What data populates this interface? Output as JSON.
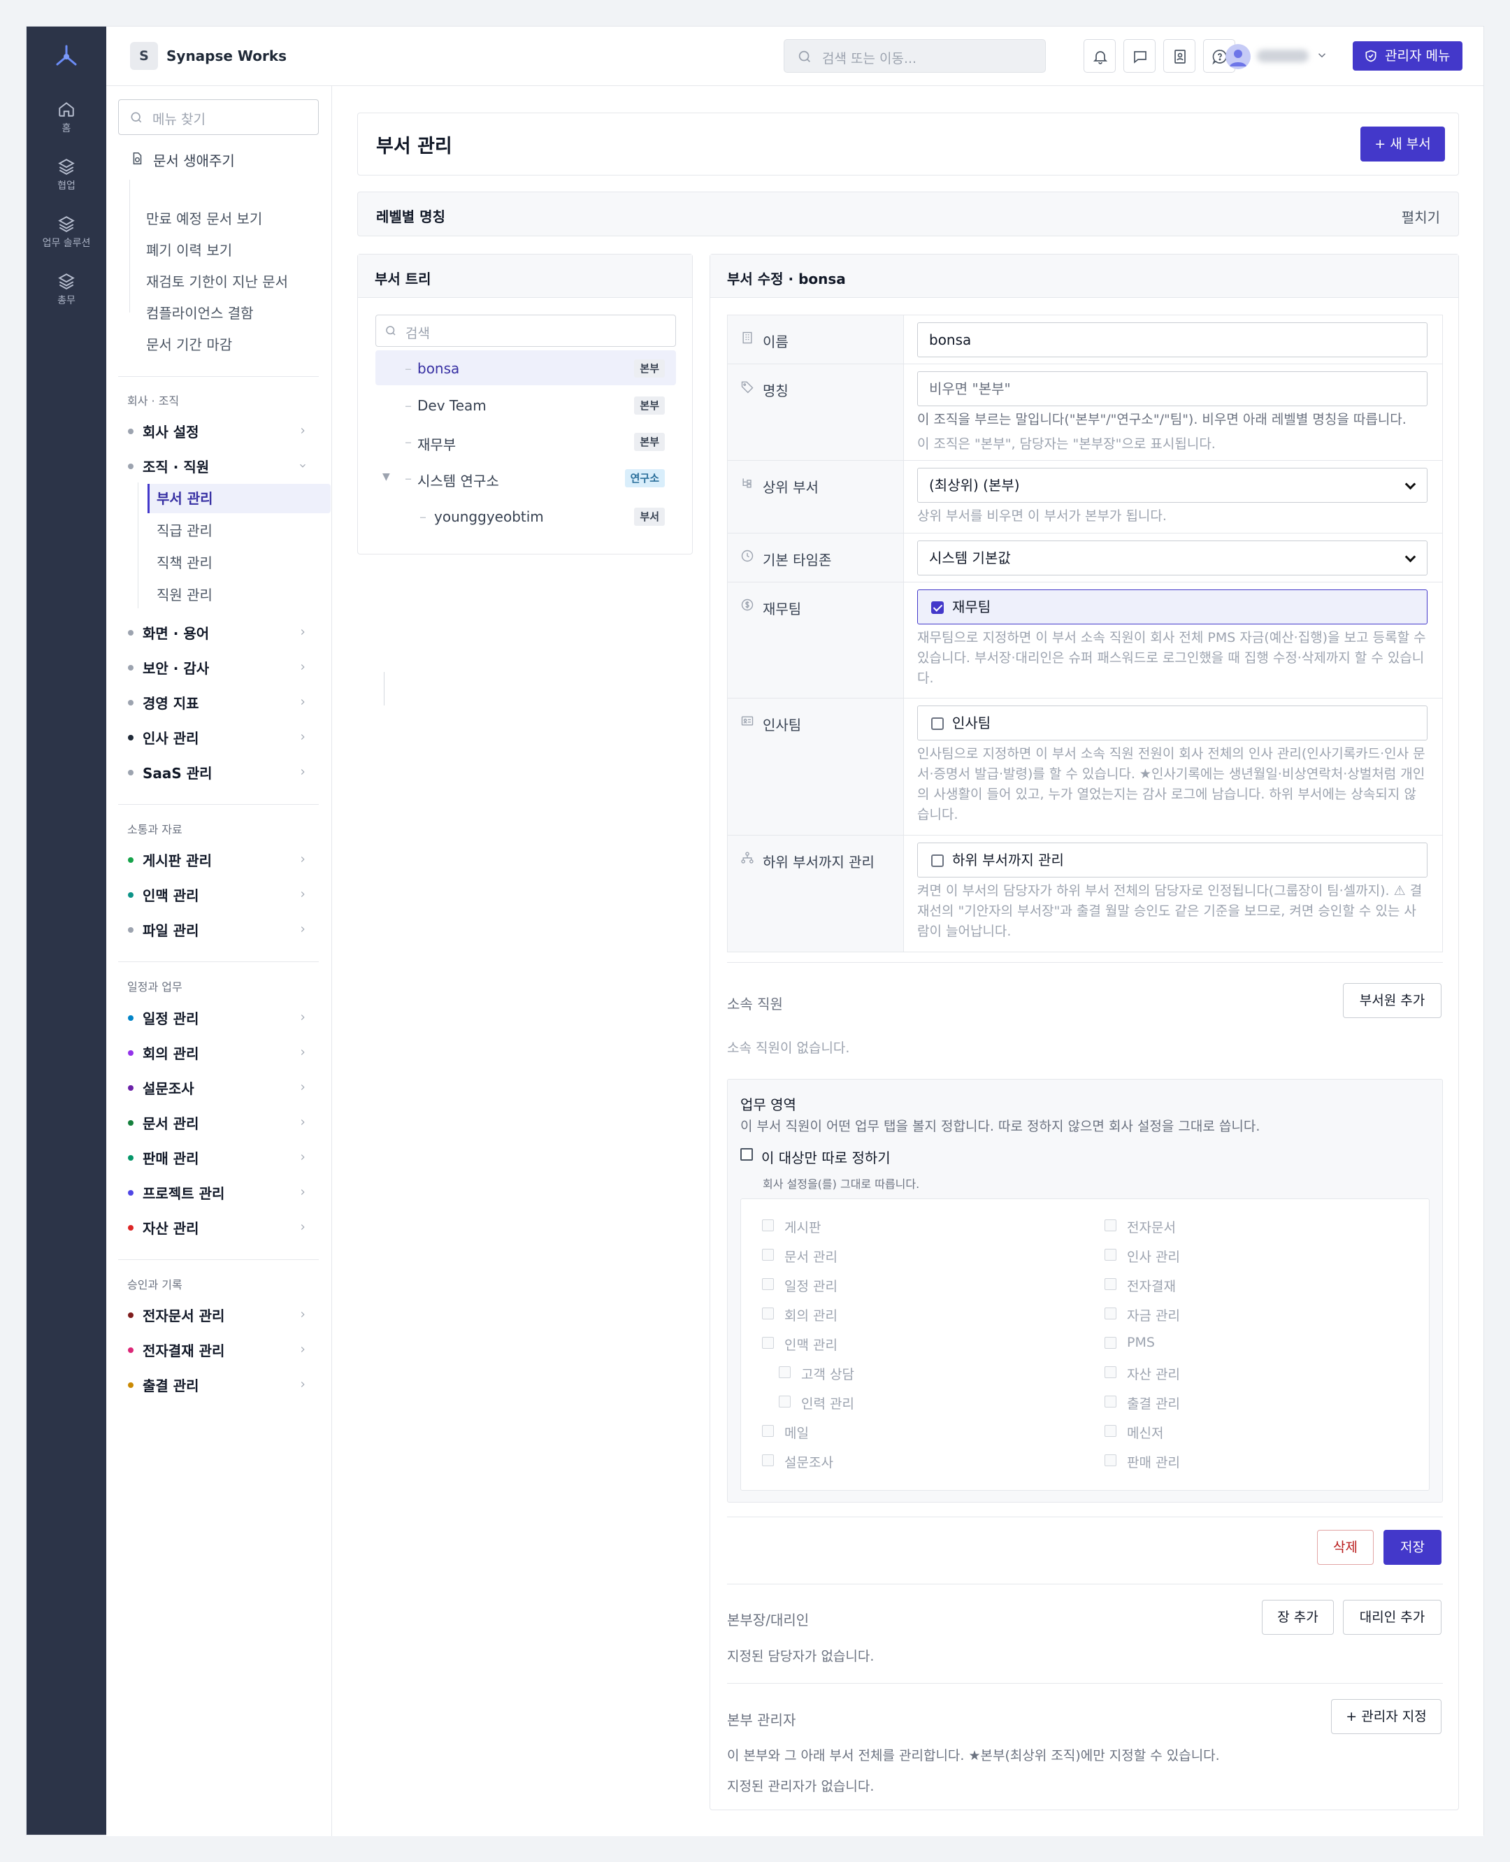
{
  "rail": {
    "items": [
      {
        "label": "홈",
        "icon": "home-icon"
      },
      {
        "label": "협업",
        "icon": "layers-icon"
      },
      {
        "label": "업무 솔루션",
        "icon": "layers-icon"
      },
      {
        "label": "총무",
        "icon": "layers-icon"
      }
    ]
  },
  "header": {
    "workspace_badge": "S",
    "workspace_name": "Synapse Works",
    "search_placeholder": "검색 또는 이동...",
    "admin_label": "관리자 메뉴"
  },
  "sidebar": {
    "search_placeholder": "메뉴 찾기",
    "lifecycle": {
      "label": "문서 생애주기",
      "items": [
        "만료 예정 문서 보기",
        "폐기 이력 보기",
        "재검토 기한이 지난 문서",
        "컴플라이언스 결함",
        "문서 기간 마감"
      ]
    },
    "groups": [
      {
        "title": "회사 · 조직",
        "items": [
          {
            "label": "회사 설정",
            "color": "#9ca3af"
          },
          {
            "label": "조직 · 직원",
            "color": "#9ca3af",
            "expanded": true,
            "subitems": [
              "부서 관리",
              "직급 관리",
              "직책 관리",
              "직원 관리"
            ]
          },
          {
            "label": "화면 · 용어",
            "color": "#9ca3af"
          },
          {
            "label": "보안 · 감사",
            "color": "#9ca3af"
          },
          {
            "label": "경영 지표",
            "color": "#9ca3af"
          },
          {
            "label": "인사 관리",
            "color": "#1f2937"
          },
          {
            "label": "SaaS 관리",
            "color": "#9ca3af"
          }
        ]
      },
      {
        "title": "소통과 자료",
        "items": [
          {
            "label": "게시판 관리",
            "color": "#16a34a"
          },
          {
            "label": "인맥 관리",
            "color": "#0d9488"
          },
          {
            "label": "파일 관리",
            "color": "#9ca3af"
          }
        ]
      },
      {
        "title": "일정과 업무",
        "items": [
          {
            "label": "일정 관리",
            "color": "#0284c7"
          },
          {
            "label": "회의 관리",
            "color": "#9333ea"
          },
          {
            "label": "설문조사",
            "color": "#6b21a8"
          },
          {
            "label": "문서 관리",
            "color": "#15803d"
          },
          {
            "label": "판매 관리",
            "color": "#059669"
          },
          {
            "label": "프로젝트 관리",
            "color": "#4f46e5"
          },
          {
            "label": "자산 관리",
            "color": "#dc2626"
          }
        ]
      },
      {
        "title": "승인과 기록",
        "items": [
          {
            "label": "전자문서 관리",
            "color": "#7f1d1d"
          },
          {
            "label": "전자결재 관리",
            "color": "#db2777"
          },
          {
            "label": "출결 관리",
            "color": "#ca8a04"
          }
        ]
      }
    ]
  },
  "main": {
    "page_title": "부서 관리",
    "new_button": "+ 새 부서",
    "level_names": {
      "title": "레벨별 명칭",
      "expand": "펼치기"
    },
    "tree": {
      "title": "부서 트리",
      "search_placeholder": "검색",
      "nodes": [
        {
          "name": "bonsa",
          "badge": "본부",
          "selected": true
        },
        {
          "name": "Dev Team",
          "badge": "본부"
        },
        {
          "name": "재무부",
          "badge": "본부"
        },
        {
          "name": "시스템 연구소",
          "badge": "연구소",
          "expanded": true
        },
        {
          "name": "younggyeobtim",
          "badge": "부서"
        }
      ]
    },
    "edit": {
      "title": "부서 수정 · bonsa",
      "fields": {
        "name": {
          "label": "이름",
          "value": "bonsa"
        },
        "designation": {
          "label": "명칭",
          "placeholder": "비우면 \"본부\"",
          "help1": "이 조직을 부르는 말입니다(\"본부\"/\"연구소\"/\"팀\"). 비우면 아래 레벨별 명칭을 따릅니다.",
          "help2": "이 조직은 \"본부\", 담당자는 \"본부장\"으로 표시됩니다."
        },
        "parent": {
          "label": "상위 부서",
          "value": "(최상위) (본부)",
          "help": "상위 부서를 비우면 이 부서가 본부가 됩니다."
        },
        "timezone": {
          "label": "기본 타임존",
          "value": "시스템 기본값"
        },
        "finance": {
          "label": "재무팀",
          "check_label": "재무팀",
          "checked": true,
          "help": "재무팀으로 지정하면 이 부서 소속 직원이 회사 전체 PMS 자금(예산·집행)을 보고 등록할 수 있습니다. 부서장·대리인은 슈퍼 패스워드로 로그인했을 때 집행 수정·삭제까지 할 수 있습니다."
        },
        "hr": {
          "label": "인사팀",
          "check_label": "인사팀",
          "checked": false,
          "help": "인사팀으로 지정하면 이 부서 소속 직원 전원이 회사 전체의 인사 관리(인사기록카드·인사 문서·증명서 발급·발령)를 할 수 있습니다. ★인사기록에는 생년월일·비상연락처·상벌처럼 개인의 사생활이 들어 있고, 누가 열었는지는 감사 로그에 남습니다. 하위 부서에는 상속되지 않습니다."
        },
        "subdept": {
          "label": "하위 부서까지 관리",
          "check_label": "하위 부서까지 관리",
          "checked": false,
          "help": "켜면 이 부서의 담당자가 하위 부서 전체의 담당자로 인정됩니다(그룹장이 팀·셀까지). ⚠ 결재선의 \"기안자의 부서장\"과 출결 월말 승인도 같은 기준을 보므로, 켜면 승인할 수 있는 사람이 늘어납니다."
        }
      },
      "members": {
        "label": "소속 직원",
        "add_button": "부서원 추가",
        "empty": "소속 직원이 없습니다."
      },
      "scope": {
        "title": "업무 영역",
        "desc": "이 부서 직원이 어떤 업무 탭을 볼지 정합니다. 따로 정하지 않으면 회사 설정을 그대로 씁니다.",
        "own_label": "이 대상만 따로 정하기",
        "own_sub": "회사 설정을(를) 그대로 따릅니다.",
        "left_modules": [
          "게시판",
          "문서 관리",
          "일정 관리",
          "회의 관리",
          "인맥 관리",
          "고객 상담",
          "인력 관리",
          "메일",
          "설문조사"
        ],
        "right_modules": [
          "전자문서",
          "인사 관리",
          "전자결재",
          "자금 관리",
          "PMS",
          "자산 관리",
          "출결 관리",
          "메신저",
          "판매 관리"
        ]
      },
      "delete_button": "삭제",
      "save_button": "저장",
      "heads": {
        "label": "본부장/대리인",
        "add_head": "장 추가",
        "add_deputy": "대리인 추가",
        "empty": "지정된 담당자가 없습니다."
      },
      "admins": {
        "label": "본부 관리자",
        "add_button": "+ 관리자 지정",
        "desc": "이 본부와 그 아래 부서 전체를 관리합니다. ★본부(최상위 조직)에만 지정할 수 있습니다.",
        "empty": "지정된 관리자가 없습니다."
      }
    }
  }
}
